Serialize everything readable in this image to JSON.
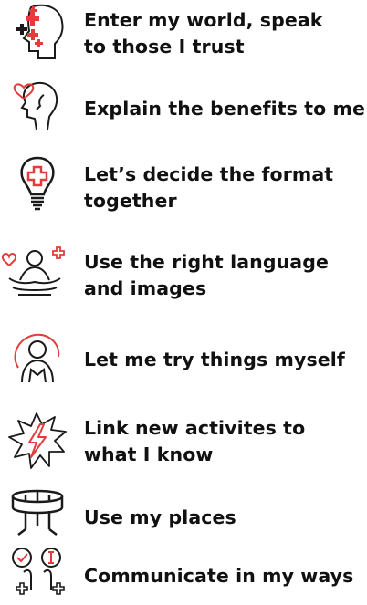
{
  "principles": [
    {
      "icon": "head-profile-medical-cross-icon",
      "text": "Enter my world, speak\nto those I trust"
    },
    {
      "icon": "head-profile-heart-icon",
      "text": "Explain the benefits to me"
    },
    {
      "icon": "lightbulb-medical-cross-icon",
      "text": "Let’s decide the format\ntogether"
    },
    {
      "icon": "meditating-person-icon",
      "text": "Use the right language\nand images"
    },
    {
      "icon": "person-hands-on-chest-icon",
      "text": "Let me try things myself"
    },
    {
      "icon": "lightning-burst-icon",
      "text": "Link new activites to\nwhat I know"
    },
    {
      "icon": "building-location-icon",
      "text": "Use my places"
    },
    {
      "icon": "people-speech-bubbles-icon",
      "text": "Communicate in my ways"
    }
  ],
  "colors": {
    "accent": "#e23c3c",
    "ink": "#1a1a1a"
  }
}
